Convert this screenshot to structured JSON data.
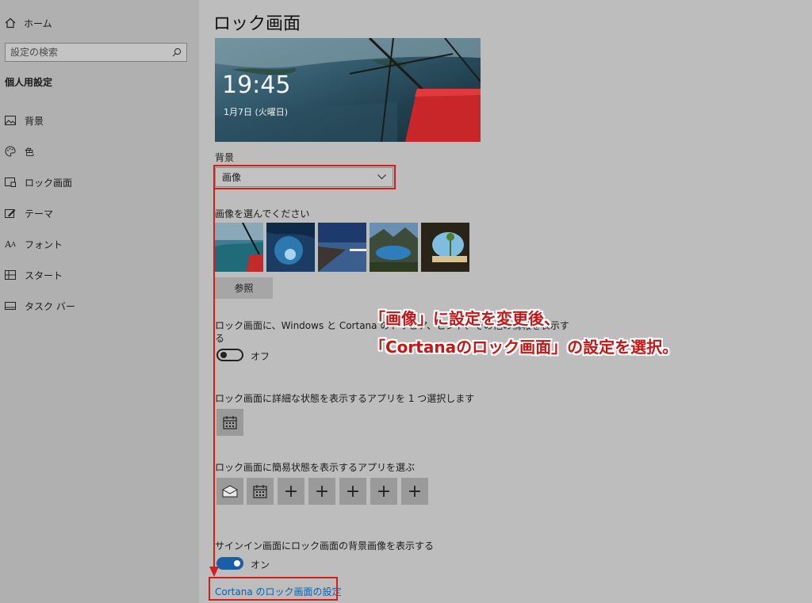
{
  "sidebar": {
    "home_label": "ホーム",
    "search_placeholder": "設定の検索",
    "section_title": "個人用設定",
    "items": [
      {
        "label": "背景",
        "icon": "picture-icon"
      },
      {
        "label": "色",
        "icon": "palette-icon"
      },
      {
        "label": "ロック画面",
        "icon": "lock-screen-icon"
      },
      {
        "label": "テーマ",
        "icon": "theme-icon"
      },
      {
        "label": "フォント",
        "icon": "font-icon"
      },
      {
        "label": "スタート",
        "icon": "start-icon"
      },
      {
        "label": "タスク バー",
        "icon": "taskbar-icon"
      }
    ]
  },
  "main": {
    "title": "ロック画面",
    "preview": {
      "time": "19:45",
      "date": "1月7日 (火曜日)"
    },
    "background_label": "背景",
    "background_value": "画像",
    "choose_picture_label": "画像を選んでください",
    "browse_label": "参照",
    "fun_facts_label_line1": "ロック画面に、Windows と Cortana のトリビア、ヒント、その他の情報を表示す",
    "fun_facts_label_line2": "る",
    "fun_facts_state": "オフ",
    "detailed_status_label": "ロック画面に詳細な状態を表示するアプリを 1 つ選択します",
    "quick_status_label": "ロック画面に簡易状態を表示するアプリを選ぶ",
    "add_symbol": "+",
    "signin_label": "サインイン画面にロック画面の背景画像を表示する",
    "signin_state": "オン",
    "cortana_link": "Cortana のロック画面の設定"
  },
  "annotation": {
    "line1": "「画像」に設定を変更後、",
    "line2": "「Cortanaのロック画面」の設定を選択。",
    "color": "#d81c1c"
  },
  "colors": {
    "accent": "#1a5fa5",
    "link": "#0b5fa8",
    "highlight": "#d81c1c"
  }
}
